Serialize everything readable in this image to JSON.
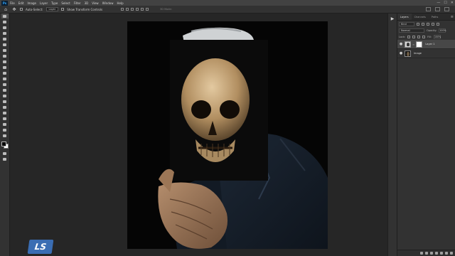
{
  "menubar": {
    "app_badge": "Ps",
    "items": [
      "File",
      "Edit",
      "Image",
      "Layer",
      "Type",
      "Select",
      "Filter",
      "3D",
      "View",
      "Window",
      "Help"
    ],
    "window_controls": [
      "—",
      "☐",
      "✕"
    ]
  },
  "options_bar": {
    "auto_select_label": "Auto-Select:",
    "auto_select_value": "Layer",
    "show_transform_label": "Show Transform Controls",
    "mode_3d_label": "3D Mode:"
  },
  "layers_panel": {
    "tabs": [
      "Layers",
      "Channels",
      "Paths"
    ],
    "filter_label": "Kind",
    "blend_mode": "Normal",
    "opacity_label": "Opacity:",
    "opacity_value": "100%",
    "lock_label": "Lock:",
    "fill_label": "Fill:",
    "fill_value": "100%",
    "layers": [
      {
        "name": "Layer 1",
        "active": true
      },
      {
        "name": "Image",
        "active": false
      }
    ]
  },
  "watermark": {
    "text": "LS"
  },
  "colors": {
    "menubar_bg": "#424242",
    "panel_bg": "#323232",
    "workspace_bg": "#262626",
    "accent": "#31a8ff",
    "watermark_bg": "#3a6db3",
    "foreground_swatch": "#000000",
    "background_swatch": "#ffffff"
  },
  "canvas_image": "composited photo: man in dark shirt holding a skull photograph over his face on black background"
}
